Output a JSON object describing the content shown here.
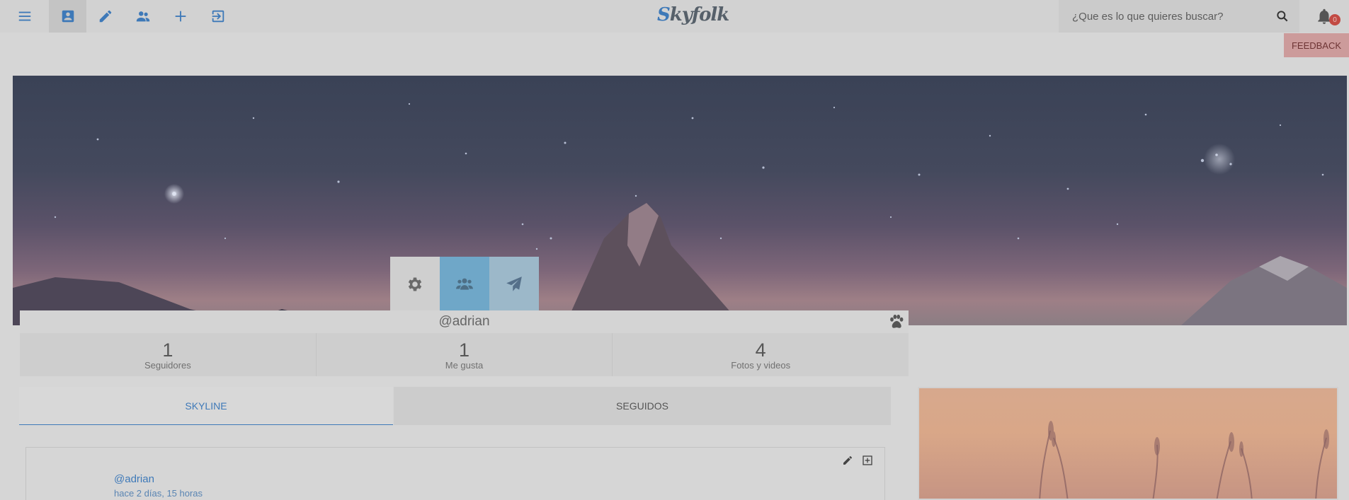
{
  "header": {
    "nav": [
      {
        "name": "menu-icon"
      },
      {
        "name": "profile-icon",
        "active": true
      },
      {
        "name": "pencil-icon"
      },
      {
        "name": "people-icon"
      },
      {
        "name": "plus-icon"
      },
      {
        "name": "logout-icon"
      }
    ],
    "logo_initial": "S",
    "logo_rest": "kyfolk",
    "search_placeholder": "¿Que es lo que quieres buscar?",
    "notification_count": "0",
    "feedback_label": "FEEDBACK"
  },
  "profile": {
    "action_icons": [
      "gear-icon",
      "users-icon",
      "paper-plane-icon"
    ],
    "username": "@adrian",
    "stats": [
      {
        "value": "1",
        "label": "Seguidores"
      },
      {
        "value": "1",
        "label": "Me gusta"
      },
      {
        "value": "4",
        "label": "Fotos y videos"
      }
    ]
  },
  "tabs": {
    "skyline": "SKYLINE",
    "seguidos": "SEGUIDOS"
  },
  "post": {
    "author": "@adrian",
    "time": "hace 2 días, 15 horas"
  },
  "colors": {
    "accent": "#3e79b8",
    "feedback": "#cc9b9b",
    "badge": "#c24a43"
  }
}
